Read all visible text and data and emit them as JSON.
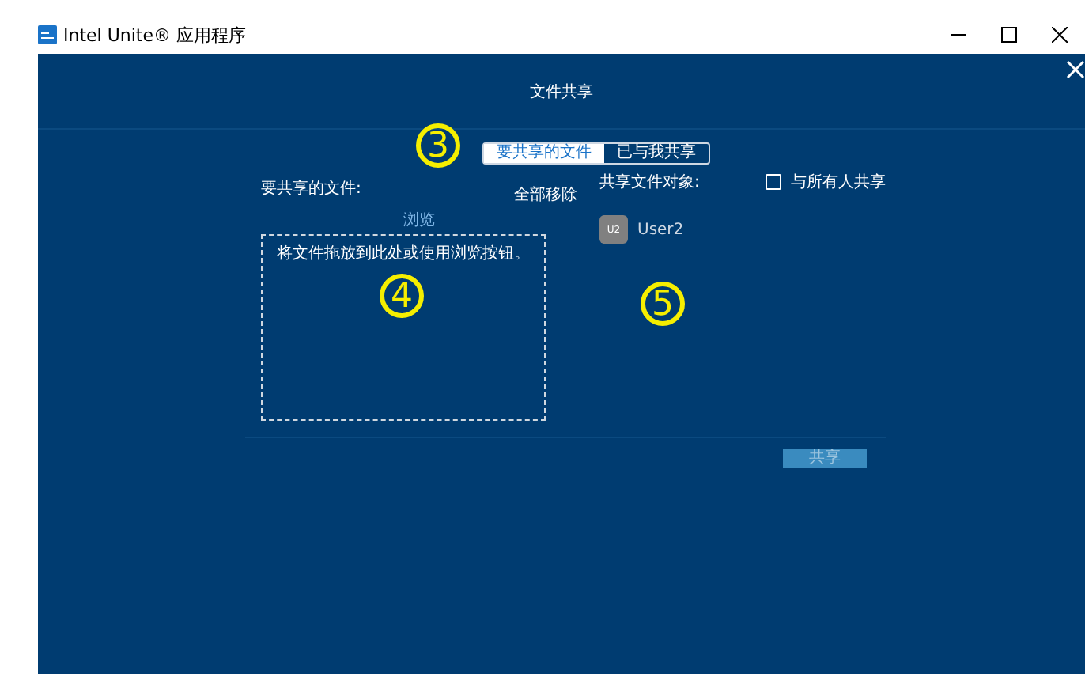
{
  "window": {
    "title": "Intel Unite® 应用程序"
  },
  "dialog": {
    "title": "文件共享"
  },
  "tabs": [
    {
      "label": "要共享的文件",
      "selected": true
    },
    {
      "label": "已与我共享",
      "selected": false
    }
  ],
  "files": {
    "label": "要共享的文件:",
    "remove_all": "全部移除",
    "browse": "浏览",
    "drop_hint": "将文件拖放到此处或使用浏览按钮。"
  },
  "recipients": {
    "label": "共享文件对象:",
    "share_all": {
      "label": "与所有人共享",
      "checked": false
    },
    "users": [
      {
        "initials": "U2",
        "name": "User2"
      }
    ]
  },
  "share_button": {
    "label": "共享",
    "disabled": true
  },
  "callouts": [
    "3",
    "4",
    "5"
  ]
}
